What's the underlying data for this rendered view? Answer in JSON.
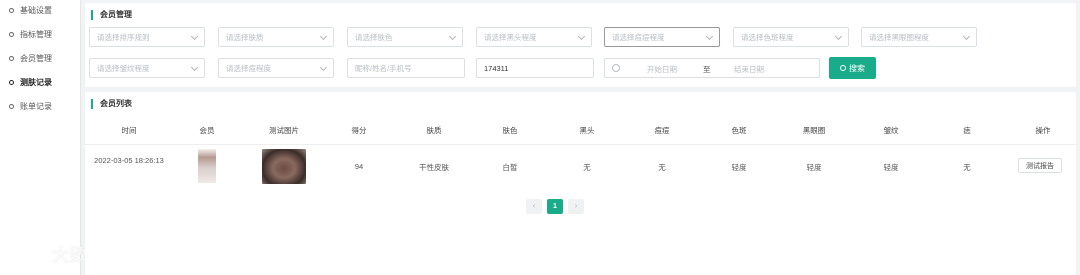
{
  "sidebar": {
    "items": [
      {
        "label": "基础设置"
      },
      {
        "label": "指标管理"
      },
      {
        "label": "会员管理"
      },
      {
        "label": "测肤记录"
      },
      {
        "label": "账单记录"
      }
    ]
  },
  "watermark": "大数跨境",
  "filter_panel": {
    "title": "会员管理",
    "selects": [
      "请选择排序规则",
      "请选择肤质",
      "请选择肤色",
      "请选择黑头程度",
      "请选择痘痘程度",
      "请选择色斑程度",
      "请选择黑眼圈程度",
      "请选择皱纹程度",
      "请选择痘程度"
    ],
    "member_input_placeholder": "昵称/姓名/手机号",
    "id_input_value": "174311",
    "date": {
      "start_placeholder": "开始日期",
      "separator": "至",
      "end_placeholder": "结束日期"
    },
    "search_label": "搜索"
  },
  "list_panel": {
    "title": "会员列表",
    "columns": [
      "时间",
      "会员",
      "测试图片",
      "得分",
      "肤质",
      "肤色",
      "黑头",
      "痘痘",
      "色斑",
      "黑眼圈",
      "皱纹",
      "痣",
      "操作"
    ],
    "rows": [
      {
        "time": "2022-03-05 18:26:13",
        "score": "94",
        "skin_type": "干性皮肤",
        "skin_color": "白皙",
        "blackhead": "无",
        "acne": "无",
        "spots": "轻度",
        "dark_circles": "轻度",
        "wrinkles": "轻度",
        "mole": "无",
        "action": "测试报告"
      }
    ],
    "pagination": {
      "prev": "‹",
      "current": "1",
      "next": "›"
    }
  },
  "colors": {
    "accent": "#1aab8a"
  }
}
